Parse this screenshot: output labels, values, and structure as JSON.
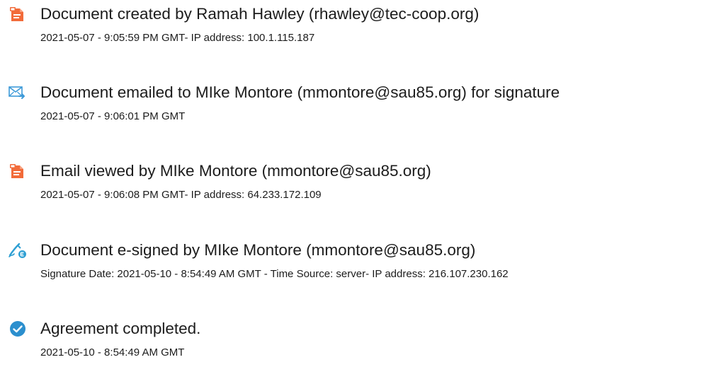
{
  "colors": {
    "doc_icon": "#f26b3a",
    "mail_icon": "#3d9ad8",
    "sign_icon": "#2e9fd3",
    "complete_icon": "#2b8fce"
  },
  "events": [
    {
      "icon": "document-icon",
      "title": "Document created by Ramah Hawley (rhawley@tec-coop.org)",
      "detail": "2021-05-07 - 9:05:59 PM GMT- IP address: 100.1.115.187"
    },
    {
      "icon": "email-sent-icon",
      "title": "Document emailed to MIke Montore (mmontore@sau85.org) for signature",
      "detail": "2021-05-07 - 9:06:01 PM GMT"
    },
    {
      "icon": "document-icon",
      "title": "Email viewed by MIke Montore (mmontore@sau85.org)",
      "detail": "2021-05-07 - 9:06:08 PM GMT- IP address: 64.233.172.109"
    },
    {
      "icon": "e-sign-pen-icon",
      "title": "Document e-signed by MIke Montore (mmontore@sau85.org)",
      "detail": "Signature Date: 2021-05-10 - 8:54:49 AM GMT - Time Source: server- IP address: 216.107.230.162"
    },
    {
      "icon": "checkmark-circle-icon",
      "title": "Agreement completed.",
      "detail": "2021-05-10 - 8:54:49 AM GMT"
    }
  ]
}
